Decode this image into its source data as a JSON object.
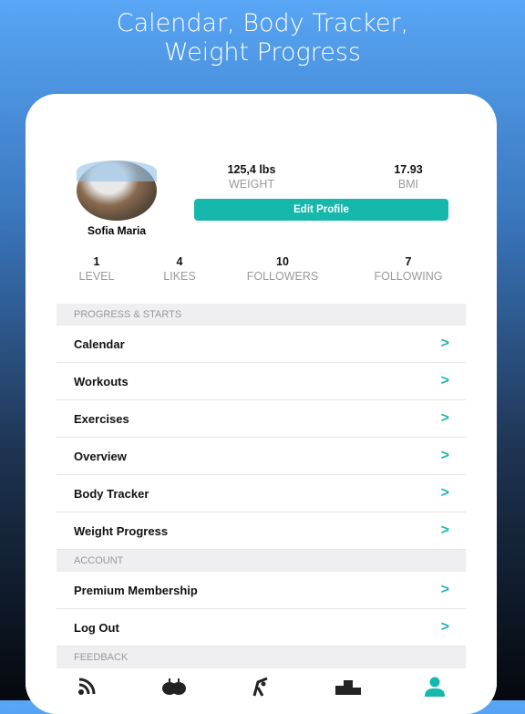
{
  "headline": {
    "line1": "Calendar, Body Tracker,",
    "line2": "Weight Progress"
  },
  "profile": {
    "name": "Sofia Maria",
    "weight": "125,4 lbs",
    "weight_label": "WEIGHT",
    "bmi": "17.93",
    "bmi_label": "BMI",
    "edit_label": "Edit Profile"
  },
  "stats": [
    {
      "value": "1",
      "label": "LEVEL"
    },
    {
      "value": "4",
      "label": "LIKES"
    },
    {
      "value": "10",
      "label": "FOLLOWERS"
    },
    {
      "value": "7",
      "label": "FOLLOWING"
    }
  ],
  "sections": {
    "progress": "PROGRESS & STARTS",
    "account": "ACCOUNT",
    "feedback": "FEEDBACK"
  },
  "progress_items": [
    "Calendar",
    "Workouts",
    "Exercises",
    "Overview",
    "Body Tracker",
    "Weight Progress"
  ],
  "account_items": [
    "Premium Membership",
    "Log Out"
  ],
  "tabs": [
    "feed-icon",
    "nutrition-apple-icon",
    "stretching-icon",
    "leaderboard-podium-icon",
    "profile-icon"
  ],
  "colors": {
    "accent": "#17b8ac"
  }
}
